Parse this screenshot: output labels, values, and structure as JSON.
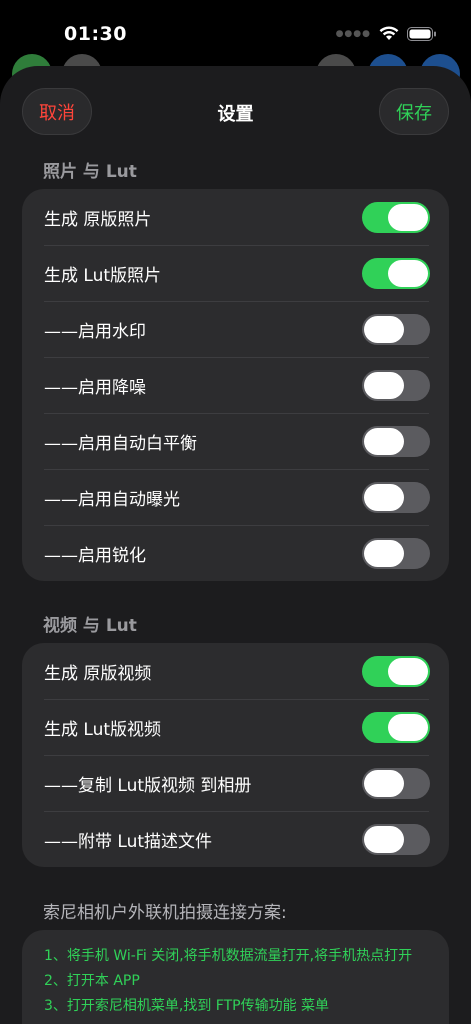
{
  "status": {
    "time": "01:30"
  },
  "nav": {
    "cancel": "取消",
    "title": "设置",
    "save": "保存"
  },
  "photo_section": {
    "title": "照片 与 Lut",
    "rows": [
      {
        "label": "生成 原版照片",
        "on": true
      },
      {
        "label": "生成 Lut版照片",
        "on": true
      },
      {
        "label": "——启用水印",
        "on": false
      },
      {
        "label": "——启用降噪",
        "on": false
      },
      {
        "label": "——启用自动白平衡",
        "on": false
      },
      {
        "label": "——启用自动曝光",
        "on": false
      },
      {
        "label": "——启用锐化",
        "on": false
      }
    ]
  },
  "video_section": {
    "title": "视频 与 Lut",
    "rows": [
      {
        "label": "生成 原版视频",
        "on": true
      },
      {
        "label": "生成 Lut版视频",
        "on": true
      },
      {
        "label": "——复制 Lut版视频 到相册",
        "on": false
      },
      {
        "label": "——附带 Lut描述文件",
        "on": false
      }
    ]
  },
  "info": {
    "title": "索尼相机户外联机拍摄连接方案:",
    "lines": [
      "1、将手机 Wi-Fi 关闭,将手机数据流量打开,将手机热点打开",
      "2、打开本 APP",
      "3、打开索尼相机菜单,找到 FTP传输功能 菜单"
    ]
  },
  "colors": {
    "accent_green": "#30d158",
    "cancel_red": "#ff453a",
    "sheet_bg": "#1c1c1e",
    "cell_bg": "#2c2c2e"
  }
}
